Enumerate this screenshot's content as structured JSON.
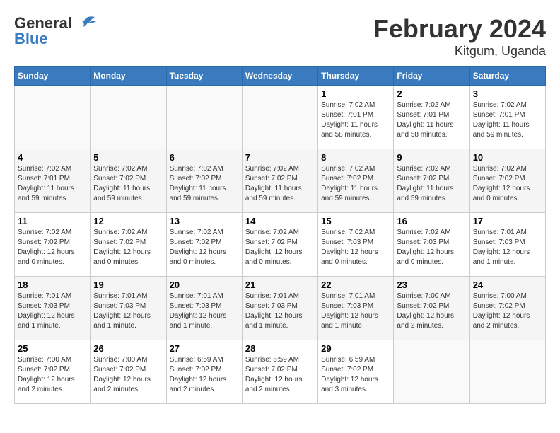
{
  "header": {
    "logo_general": "General",
    "logo_blue": "Blue",
    "month_title": "February 2024",
    "location": "Kitgum, Uganda"
  },
  "weekdays": [
    "Sunday",
    "Monday",
    "Tuesday",
    "Wednesday",
    "Thursday",
    "Friday",
    "Saturday"
  ],
  "weeks": [
    [
      {
        "day": "",
        "empty": true
      },
      {
        "day": "",
        "empty": true
      },
      {
        "day": "",
        "empty": true
      },
      {
        "day": "",
        "empty": true
      },
      {
        "day": "1",
        "sunrise": "7:02 AM",
        "sunset": "7:01 PM",
        "daylight": "11 hours and 58 minutes."
      },
      {
        "day": "2",
        "sunrise": "7:02 AM",
        "sunset": "7:01 PM",
        "daylight": "11 hours and 58 minutes."
      },
      {
        "day": "3",
        "sunrise": "7:02 AM",
        "sunset": "7:01 PM",
        "daylight": "11 hours and 59 minutes."
      }
    ],
    [
      {
        "day": "4",
        "sunrise": "7:02 AM",
        "sunset": "7:01 PM",
        "daylight": "11 hours and 59 minutes."
      },
      {
        "day": "5",
        "sunrise": "7:02 AM",
        "sunset": "7:02 PM",
        "daylight": "11 hours and 59 minutes."
      },
      {
        "day": "6",
        "sunrise": "7:02 AM",
        "sunset": "7:02 PM",
        "daylight": "11 hours and 59 minutes."
      },
      {
        "day": "7",
        "sunrise": "7:02 AM",
        "sunset": "7:02 PM",
        "daylight": "11 hours and 59 minutes."
      },
      {
        "day": "8",
        "sunrise": "7:02 AM",
        "sunset": "7:02 PM",
        "daylight": "11 hours and 59 minutes."
      },
      {
        "day": "9",
        "sunrise": "7:02 AM",
        "sunset": "7:02 PM",
        "daylight": "11 hours and 59 minutes."
      },
      {
        "day": "10",
        "sunrise": "7:02 AM",
        "sunset": "7:02 PM",
        "daylight": "12 hours and 0 minutes."
      }
    ],
    [
      {
        "day": "11",
        "sunrise": "7:02 AM",
        "sunset": "7:02 PM",
        "daylight": "12 hours and 0 minutes."
      },
      {
        "day": "12",
        "sunrise": "7:02 AM",
        "sunset": "7:02 PM",
        "daylight": "12 hours and 0 minutes."
      },
      {
        "day": "13",
        "sunrise": "7:02 AM",
        "sunset": "7:02 PM",
        "daylight": "12 hours and 0 minutes."
      },
      {
        "day": "14",
        "sunrise": "7:02 AM",
        "sunset": "7:02 PM",
        "daylight": "12 hours and 0 minutes."
      },
      {
        "day": "15",
        "sunrise": "7:02 AM",
        "sunset": "7:03 PM",
        "daylight": "12 hours and 0 minutes."
      },
      {
        "day": "16",
        "sunrise": "7:02 AM",
        "sunset": "7:03 PM",
        "daylight": "12 hours and 0 minutes."
      },
      {
        "day": "17",
        "sunrise": "7:01 AM",
        "sunset": "7:03 PM",
        "daylight": "12 hours and 1 minute."
      }
    ],
    [
      {
        "day": "18",
        "sunrise": "7:01 AM",
        "sunset": "7:03 PM",
        "daylight": "12 hours and 1 minute."
      },
      {
        "day": "19",
        "sunrise": "7:01 AM",
        "sunset": "7:03 PM",
        "daylight": "12 hours and 1 minute."
      },
      {
        "day": "20",
        "sunrise": "7:01 AM",
        "sunset": "7:03 PM",
        "daylight": "12 hours and 1 minute."
      },
      {
        "day": "21",
        "sunrise": "7:01 AM",
        "sunset": "7:03 PM",
        "daylight": "12 hours and 1 minute."
      },
      {
        "day": "22",
        "sunrise": "7:01 AM",
        "sunset": "7:03 PM",
        "daylight": "12 hours and 1 minute."
      },
      {
        "day": "23",
        "sunrise": "7:00 AM",
        "sunset": "7:02 PM",
        "daylight": "12 hours and 2 minutes."
      },
      {
        "day": "24",
        "sunrise": "7:00 AM",
        "sunset": "7:02 PM",
        "daylight": "12 hours and 2 minutes."
      }
    ],
    [
      {
        "day": "25",
        "sunrise": "7:00 AM",
        "sunset": "7:02 PM",
        "daylight": "12 hours and 2 minutes."
      },
      {
        "day": "26",
        "sunrise": "7:00 AM",
        "sunset": "7:02 PM",
        "daylight": "12 hours and 2 minutes."
      },
      {
        "day": "27",
        "sunrise": "6:59 AM",
        "sunset": "7:02 PM",
        "daylight": "12 hours and 2 minutes."
      },
      {
        "day": "28",
        "sunrise": "6:59 AM",
        "sunset": "7:02 PM",
        "daylight": "12 hours and 2 minutes."
      },
      {
        "day": "29",
        "sunrise": "6:59 AM",
        "sunset": "7:02 PM",
        "daylight": "12 hours and 3 minutes."
      },
      {
        "day": "",
        "empty": true
      },
      {
        "day": "",
        "empty": true
      }
    ]
  ]
}
